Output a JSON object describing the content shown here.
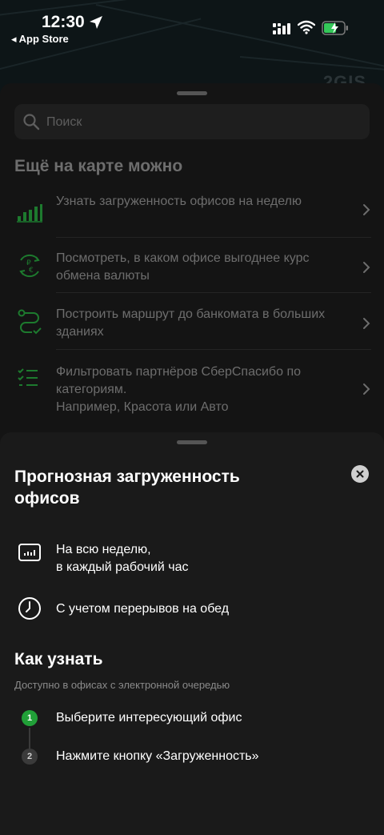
{
  "status_bar": {
    "time": "12:30",
    "back_label": "◂ App Store"
  },
  "map": {
    "logo": "2GIS"
  },
  "search": {
    "placeholder": "Поиск"
  },
  "more_section": {
    "title": "Ещё на карте можно",
    "items": [
      {
        "label": "Узнать загруженность офисов на неделю",
        "icon": "bar-chart-icon"
      },
      {
        "label": "Посмотреть, в каком офисе выгоднее курс обмена валюты",
        "icon": "currency-exchange-icon"
      },
      {
        "label": "Построить маршрут до банкомата в больших зданиях",
        "icon": "route-icon"
      },
      {
        "label": "Фильтровать партнёров СберСпасибо по категориям.\nНапример, Красота или Авто",
        "icon": "filter-list-icon"
      }
    ]
  },
  "panel": {
    "title": "Прогнозная загруженность офисов",
    "benefits": [
      {
        "text": "На всю неделю,\nв каждый рабочий час",
        "icon": "chart-screen-icon"
      },
      {
        "text": "С учетом перерывов на обед",
        "icon": "clock-icon"
      }
    ],
    "how_title": "Как узнать",
    "how_subtitle": "Доступно в офисах с электронной очередью",
    "steps": [
      {
        "number": "1",
        "text": "Выберите интересующий офис"
      },
      {
        "number": "2",
        "text": "Нажмите кнопку «Загруженность»"
      }
    ]
  },
  "colors": {
    "accent_green": "#21a038",
    "sheet_background": "#1a1a1a",
    "muted_text": "#6d6d6d"
  }
}
